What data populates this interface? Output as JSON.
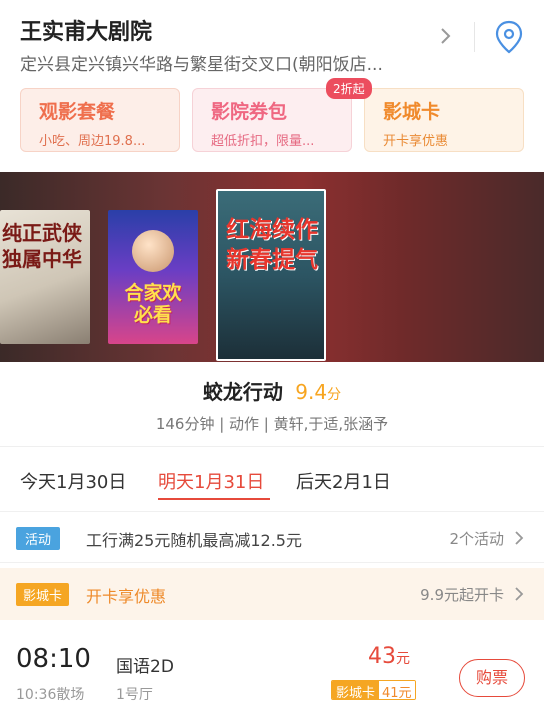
{
  "cinema": {
    "name": "王实甫大剧院",
    "address": "定兴县定兴镇兴华路与繁星街交叉口(朝阳饭店..."
  },
  "cards": [
    {
      "title": "观影套餐",
      "subtitle": "小吃、周边19.8..."
    },
    {
      "title": "影院券包",
      "subtitle": "超低折扣，限量...",
      "badge": "2折起"
    },
    {
      "title": "影城卡",
      "subtitle": "开卡享优惠"
    }
  ],
  "posters": {
    "p1": "纯正武侠独属中华",
    "p2": "合家欢必看",
    "p3": "红海续作新春提气"
  },
  "movie": {
    "title": "蛟龙行动",
    "score": "9.4",
    "score_unit": "分",
    "meta": "146分钟 | 动作 | 黄轩,于适,张涵予"
  },
  "dates": [
    {
      "label": "今天1月30日"
    },
    {
      "label": "明天1月31日"
    },
    {
      "label": "后天2月1日"
    }
  ],
  "activity_row": {
    "tag": "活动",
    "text": "工行满25元随机最高减12.5元",
    "right": "2个活动"
  },
  "card_row": {
    "tag": "影城卡",
    "text": "开卡享优惠",
    "right": "9.9元起开卡"
  },
  "showtime": {
    "start": "08:10",
    "end": "10:36散场",
    "language": "国语2D",
    "hall": "1号厅",
    "price": "43",
    "price_unit": "元",
    "card_label": "影城卡",
    "card_price": "41元",
    "buy_label": "购票"
  },
  "colors": {
    "accent_red": "#e64a3b",
    "score_gold": "#f7a520",
    "activity_blue": "#4aa3df",
    "card_orange": "#f5a623"
  }
}
